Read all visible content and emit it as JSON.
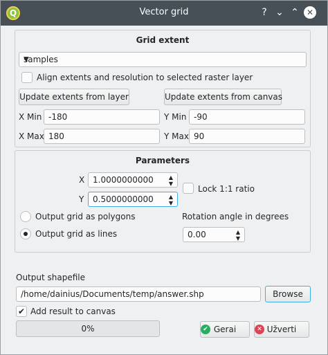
{
  "window": {
    "title": "Vector grid",
    "app_icon_letter": "Q",
    "help_glyph": "?",
    "minimize_glyph": "⌄",
    "maximize_glyph": "⌃",
    "close_glyph": "✕"
  },
  "grid_extent": {
    "title": "Grid extent",
    "layer_combo": "samples",
    "align_checkbox_label": "Align extents and resolution to selected raster layer",
    "align_checked": false,
    "update_from_layer": "Update extents from layer",
    "update_from_canvas": "Update extents from canvas",
    "xmin_label": "X Min",
    "xmin_value": "-180",
    "ymin_label": "Y Min",
    "ymin_value": "-90",
    "xmax_label": "X Max",
    "xmax_value": "180",
    "ymax_label": "Y Max",
    "ymax_value": "90"
  },
  "parameters": {
    "title": "Parameters",
    "x_label": "X",
    "x_value": "1.0000000000",
    "y_label": "Y",
    "y_value": "0.5000000000",
    "lock_ratio_label": "Lock 1:1 ratio",
    "lock_ratio_checked": false,
    "polygons_label": "Output grid as polygons",
    "lines_label": "Output grid as lines",
    "selected_output": "lines",
    "rotation_label": "Rotation angle in degrees",
    "rotation_value": "0.00"
  },
  "output": {
    "label": "Output shapefile",
    "path": "/home/dainius/Documents/temp/answer.shp",
    "browse_label": "Browse",
    "add_to_canvas_label": "Add result to canvas",
    "add_to_canvas_checked": true,
    "check_glyph": "✔"
  },
  "progress": {
    "value": 0,
    "text": "0%"
  },
  "buttons": {
    "ok_label": "Gerai",
    "cancel_label": "Užverti",
    "ok_icon_glyph": "✔",
    "cancel_icon_glyph": "✕"
  },
  "colors": {
    "titlebar": "#475057",
    "window_bg": "#eff0f1",
    "focus_accent": "#3daee9",
    "ok_icon": "#27ae60",
    "cancel_icon": "#da4453"
  }
}
